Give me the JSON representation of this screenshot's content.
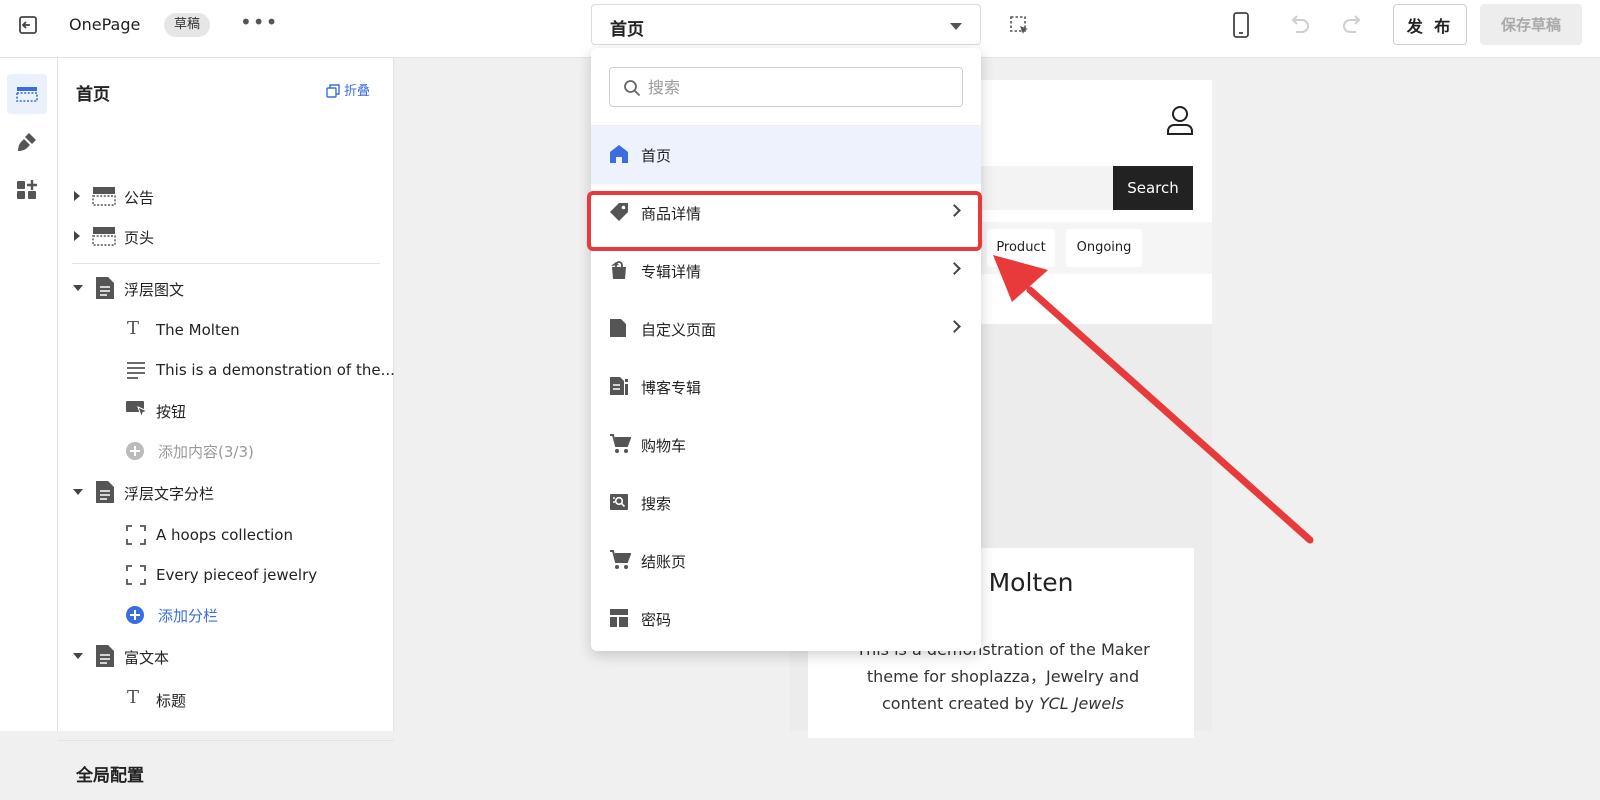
{
  "topbar": {
    "app_name": "OnePage",
    "badge": "草稿",
    "more": "•••",
    "page_select_value": "首页",
    "publish_label": "发 布",
    "save_label": "保存草稿"
  },
  "sidebar": {
    "title": "首页",
    "collapse_label": "折叠",
    "tree": {
      "announcement": "公告",
      "header": "页头",
      "image_overlay": "浮层图文",
      "image_overlay_children": [
        "The Molten",
        "This is a demonstration of the...",
        "按钮"
      ],
      "add_content": "添加内容(3/3)",
      "text_columns": "浮层文字分栏",
      "text_columns_children": [
        "A hoops collection",
        "Every pieceof jewelry"
      ],
      "add_column": "添加分栏",
      "rich_text": "富文本",
      "rich_text_children": [
        "标题"
      ]
    },
    "footer_label": "全局配置"
  },
  "dropdown": {
    "search_placeholder": "搜索",
    "items": [
      {
        "label": "首页",
        "icon": "home-icon",
        "active": true,
        "submenu": false
      },
      {
        "label": "商品详情",
        "icon": "tag-icon",
        "active": false,
        "submenu": true
      },
      {
        "label": "专辑详情",
        "icon": "shopping-bag-icon",
        "active": false,
        "submenu": true
      },
      {
        "label": "自定义页面",
        "icon": "document-icon",
        "active": false,
        "submenu": true
      },
      {
        "label": "博客专辑",
        "icon": "blog-icon",
        "active": false,
        "submenu": false
      },
      {
        "label": "购物车",
        "icon": "cart-icon",
        "active": false,
        "submenu": false
      },
      {
        "label": "搜索",
        "icon": "search-page-icon",
        "active": false,
        "submenu": false
      },
      {
        "label": "结账页",
        "icon": "checkout-cart-icon",
        "active": false,
        "submenu": false
      },
      {
        "label": "密码",
        "icon": "password-layout-icon",
        "active": false,
        "submenu": false
      }
    ]
  },
  "preview": {
    "search_button": "Search",
    "chips": [
      "Product",
      "Ongoing"
    ],
    "card_title": "Molten",
    "card_body_line1": "This is a demonstration of the Maker",
    "card_body_line2": "theme for shoplazza，Jewelry and",
    "card_body_line3": "content created by ",
    "card_body_em": "YCL Jewels"
  },
  "colors": {
    "accent": "#3b6de0",
    "annotation": "#e83a3a",
    "active_bg": "#edf2fc"
  }
}
